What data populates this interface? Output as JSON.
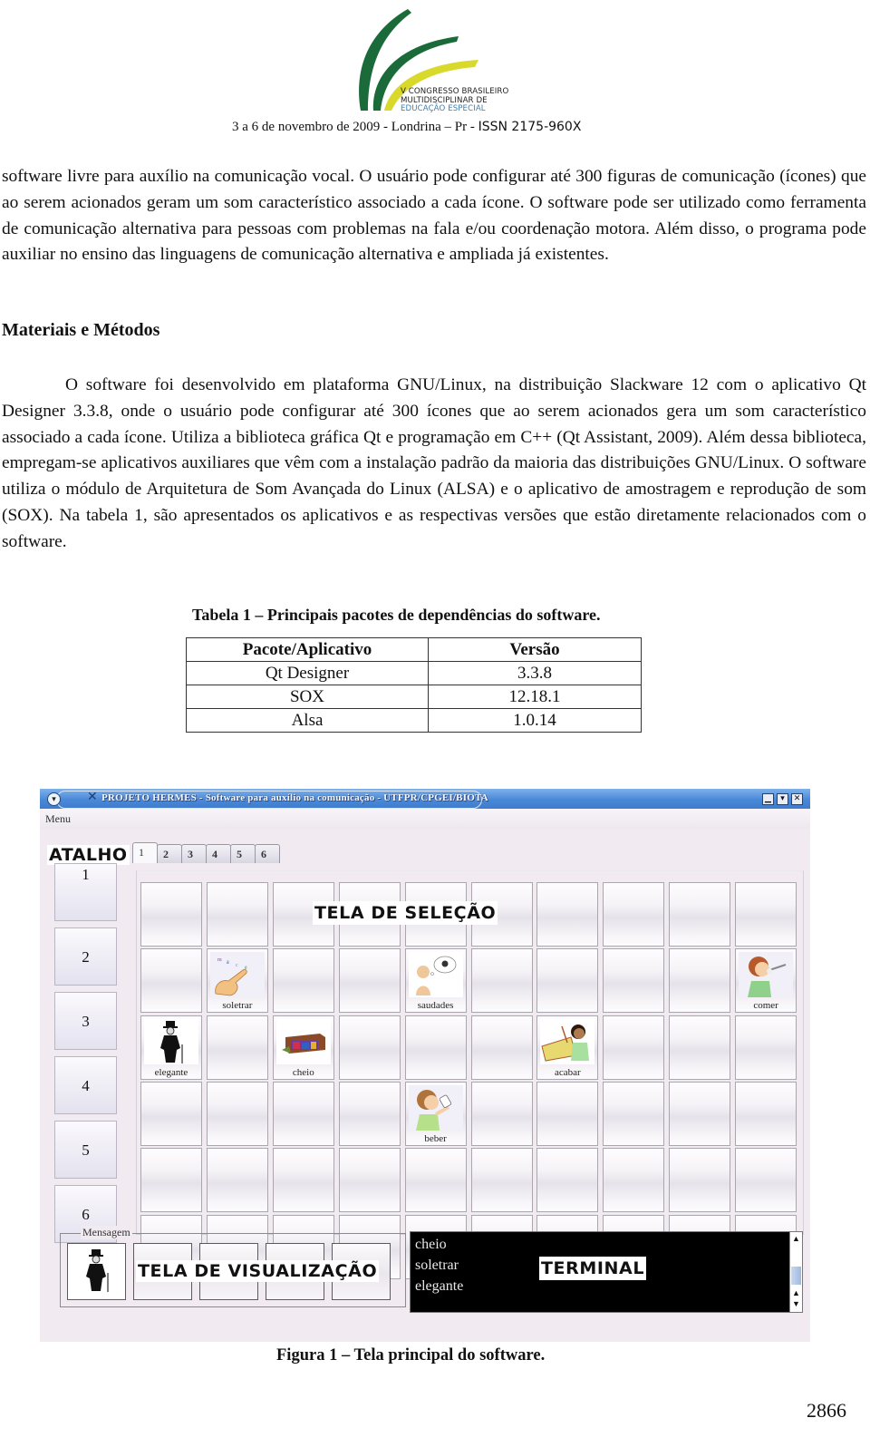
{
  "header": {
    "logo_lines": [
      "V CONGRESSO BRASILEIRO",
      "MULTIDISCIPLINAR DE",
      "EDUCAÇÃO ESPECIAL"
    ],
    "event_line": "3 a 6 de novembro de 2009 -  Londrina – Pr - ",
    "issn": "ISSN 2175-960X",
    "logo_colors": {
      "green": "#1b6b3a",
      "yellow": "#d8d92a",
      "blue": "#3d7fb0"
    }
  },
  "paragraphs": {
    "p1": "software livre para auxílio na comunicação vocal. O usuário pode configurar até 300 figuras de comunicação (ícones) que ao serem acionados geram um som característico associado a cada ícone. O software pode ser utilizado como ferramenta de comunicação alternativa para pessoas com problemas na fala e/ou coordenação motora. Além disso, o programa pode auxiliar no ensino das linguagens de comunicação alternativa e ampliada já existentes.",
    "heading": "Materiais e Métodos",
    "p2": "O software foi desenvolvido em plataforma GNU/Linux, na distribuição Slackware 12 com o aplicativo Qt Designer 3.3.8, onde o usuário pode configurar até 300 ícones que ao serem acionados gera um som característico associado a cada ícone. Utiliza a biblioteca gráfica Qt e programação em C++ (Qt Assistant, 2009). Além dessa biblioteca, empregam-se aplicativos auxiliares que vêm com a instalação padrão da maioria das distribuições GNU/Linux. O software utiliza o módulo de Arquitetura de Som Avançada do Linux (ALSA) e o aplicativo de amostragem e reprodução de som (SOX). Na tabela 1, são apresentados os aplicativos e as respectivas versões que estão diretamente relacionados com o software."
  },
  "table": {
    "caption": "Tabela 1 – Principais pacotes de dependências do software.",
    "headers": [
      "Pacote/Aplicativo",
      "Versão"
    ],
    "rows": [
      [
        "Qt Designer",
        "3.3.8"
      ],
      [
        "SOX",
        "12.18.1"
      ],
      [
        "Alsa",
        "1.0.14"
      ]
    ]
  },
  "app": {
    "window_title": "PROJETO HERMES - Software para auxílio na comunicação - UTFPR/CPGEI/BIOTA",
    "window_buttons": {
      "minimize": "▁",
      "maximize": "▾",
      "close": "✕"
    },
    "menu": "Menu",
    "atalho_label": "ATALHO",
    "tabs": [
      "1",
      "2",
      "3",
      "4",
      "5",
      "6"
    ],
    "active_tab": "1",
    "side_buttons": [
      "1",
      "2",
      "3",
      "4",
      "5",
      "6"
    ],
    "selection_label": "TELA DE SELEÇÃO",
    "grid": {
      "rows": 6,
      "cols": 10,
      "icons": [
        {
          "row": 1,
          "col": 1,
          "label": "soletrar",
          "icon": "spelling-hand-icon"
        },
        {
          "row": 1,
          "col": 4,
          "label": "saudades",
          "icon": "missing-someone-icon"
        },
        {
          "row": 1,
          "col": 9,
          "label": "comer",
          "icon": "eating-boy-icon"
        },
        {
          "row": 2,
          "col": 0,
          "label": "elegante",
          "icon": "elegant-man-icon"
        },
        {
          "row": 2,
          "col": 2,
          "label": "cheio",
          "icon": "full-box-icon"
        },
        {
          "row": 2,
          "col": 6,
          "label": "acabar",
          "icon": "finish-girl-box-icon"
        },
        {
          "row": 3,
          "col": 4,
          "label": "beber",
          "icon": "drinking-boy-icon"
        }
      ]
    },
    "message_legend": "Mensagem",
    "message_slots": 5,
    "message_filled": [
      "elegant-man-icon"
    ],
    "visualization_label": "TELA DE VISUALIZAÇÃO",
    "terminal_lines": [
      "cheio",
      "soletrar",
      "elegante"
    ],
    "terminal_label": "TERMINAL",
    "colors": {
      "titlebar": "#4a88d8",
      "window_bg": "#f1ebf1",
      "terminal_bg": "#000000"
    }
  },
  "figure_caption": "Figura 1 – Tela principal do software.",
  "page_number": "2866"
}
